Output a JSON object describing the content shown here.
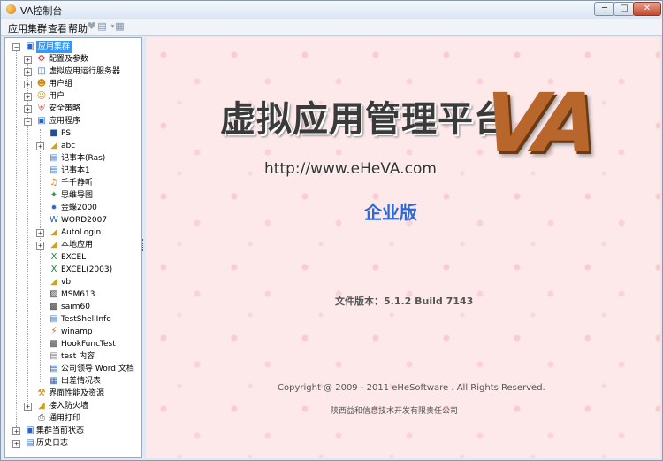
{
  "window": {
    "title": "VA控制台"
  },
  "menu": {
    "items": [
      "应用集群",
      "查看",
      "帮助"
    ]
  },
  "tree": {
    "root": "应用集群",
    "level1": [
      "配置及参数",
      "虚拟应用运行服务器",
      "用户组",
      "用户",
      "安全策略"
    ],
    "app_folder": "应用程序",
    "apps": [
      "PS",
      "abc",
      "记事本(Ras)",
      "记事本1",
      "千千静听",
      "思维导图",
      "金蝶2000",
      "WORD2007",
      "AutoLogin",
      "本地应用",
      "EXCEL",
      "EXCEL(2003)",
      "vb",
      "MSM613",
      "saim60",
      "TestShellInfo",
      "winamp",
      "HookFuncTest",
      "test 内容",
      "公司领导 Word 文档",
      "出差情况表"
    ],
    "after_apps": [
      "界面性能及资源",
      "接入防火墙",
      "通用打印"
    ],
    "bottom": [
      "集群当前状态",
      "历史日志"
    ]
  },
  "splash": {
    "headline": "虚拟应用管理平台",
    "logo": "VA",
    "url": "http://www.eHeVA.com",
    "edition": "企业版",
    "version": "文件版本：5.1.2 Build 7143",
    "copyright": "Copyright @ 2009 - 2011 eHeSoftware . All Rights Reserved.",
    "company": "陕西益和信息技术开发有限责任公司"
  },
  "colors": {
    "selection": "#3399ff",
    "logo": "#b8662c",
    "edition": "#2b6ad6",
    "background": "#fde8ea"
  }
}
